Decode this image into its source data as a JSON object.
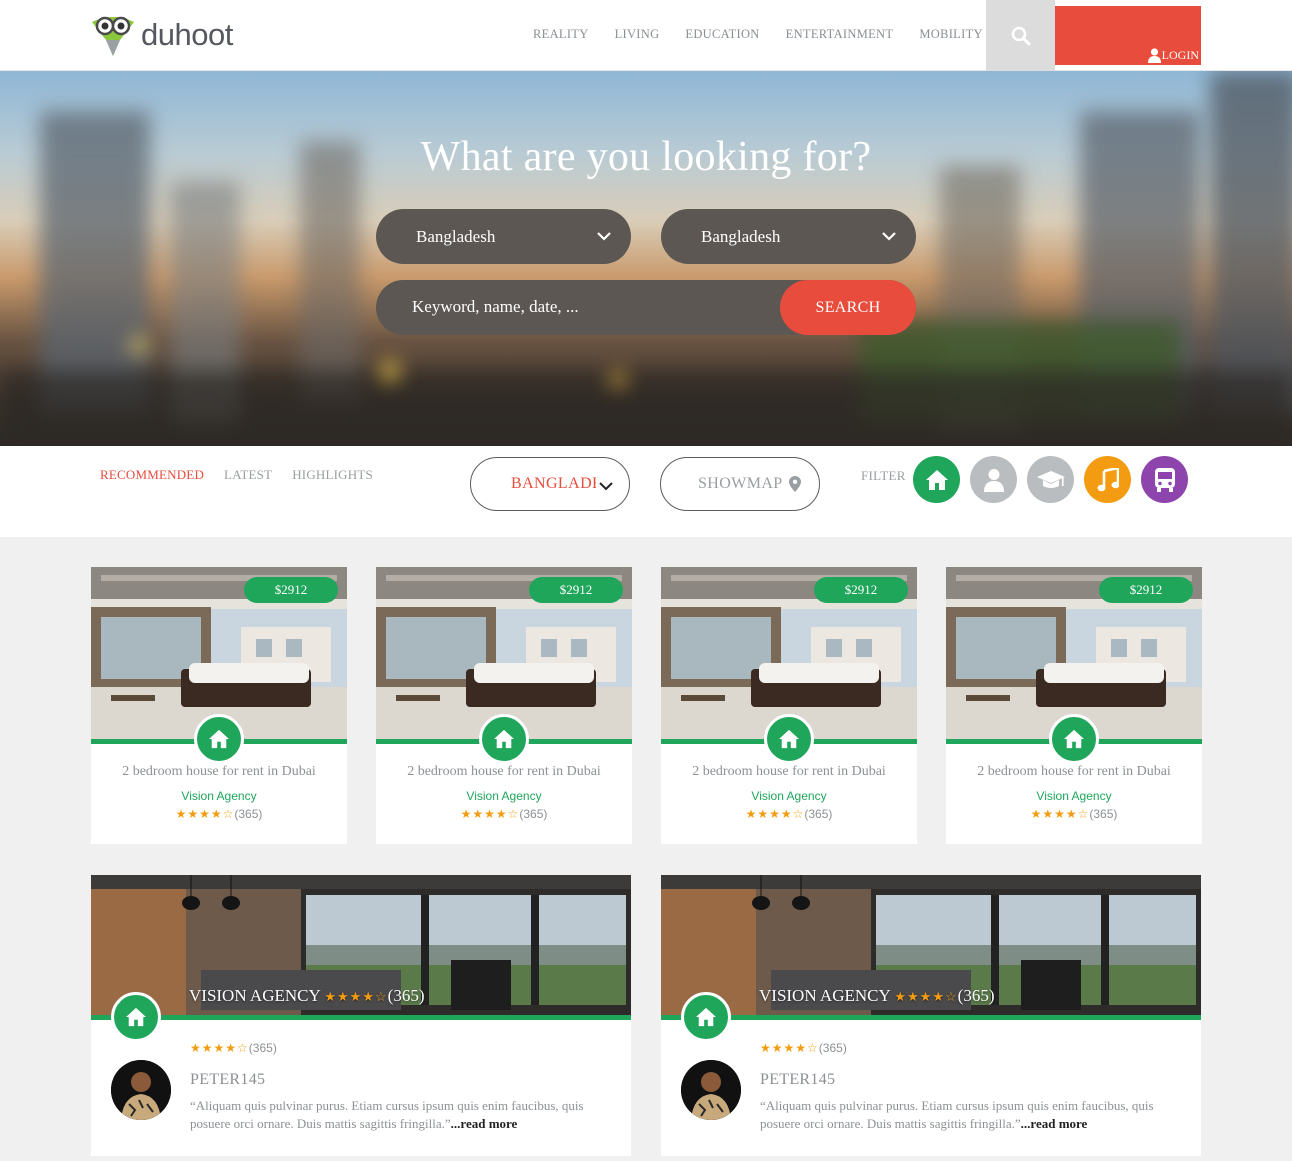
{
  "header": {
    "logo_text": "duhoot",
    "nav": [
      "REALITY",
      "LIVING",
      "EDUCATION",
      "ENTERTAINMENT",
      "MOBILITY"
    ],
    "login_label": "LOGIN"
  },
  "hero": {
    "title": "What are you looking for?",
    "select_country": "Bangladesh",
    "select_city": "Bangladesh",
    "keyword_placeholder": "Keyword, name, date, ...",
    "search_label": "SEARCH"
  },
  "filterbar": {
    "tabs": [
      "RECOMMENDED",
      "LATEST",
      "HIGHLIGHTS"
    ],
    "country_value": "BANGLADESH",
    "showmap_label": "SHOWMAP",
    "filter_label": "FILTER",
    "categories": [
      {
        "icon": "home-icon",
        "color": "#1fa65b"
      },
      {
        "icon": "user-icon",
        "color": "#b9bdbf"
      },
      {
        "icon": "graduation-cap-icon",
        "color": "#b9bdbf"
      },
      {
        "icon": "music-icon",
        "color": "#f39c12"
      },
      {
        "icon": "bus-icon",
        "color": "#8e44ad"
      }
    ]
  },
  "listings": [
    {
      "price": "$2912",
      "title": "2 bedroom house for rent in Dubai",
      "agency": "Vision Agency",
      "stars": "★★★★☆",
      "count": "(365)"
    },
    {
      "price": "$2912",
      "title": "2 bedroom house for rent in Dubai",
      "agency": "Vision Agency",
      "stars": "★★★★☆",
      "count": "(365)"
    },
    {
      "price": "$2912",
      "title": "2 bedroom house for rent in Dubai",
      "agency": "Vision Agency",
      "stars": "★★★★☆",
      "count": "(365)"
    },
    {
      "price": "$2912",
      "title": "2 bedroom house for rent in Dubai",
      "agency": "Vision Agency",
      "stars": "★★★★☆",
      "count": "(365)"
    }
  ],
  "reviews": [
    {
      "agency": "VISION AGENCY",
      "stars": "★★★★☆",
      "count": "(365)",
      "user": "PETER145",
      "text": "“Aliquam quis pulvinar purus. Etiam cursus ipsum quis enim faucibus, quis posuere orci ornare. Duis mattis sagittis fringilla.”",
      "read_more": "...read more"
    },
    {
      "agency": "VISION AGENCY",
      "stars": "★★★★☆",
      "count": "(365)",
      "user": "PETER145",
      "text": "“Aliquam quis pulvinar purus. Etiam cursus ipsum quis enim faucibus, quis posuere orci ornare. Duis mattis sagittis fringilla.”",
      "read_more": "...read more"
    }
  ],
  "colors": {
    "accent": "#e84c3d",
    "green": "#1fa65b",
    "orange": "#f39c12",
    "purple": "#8e44ad"
  }
}
